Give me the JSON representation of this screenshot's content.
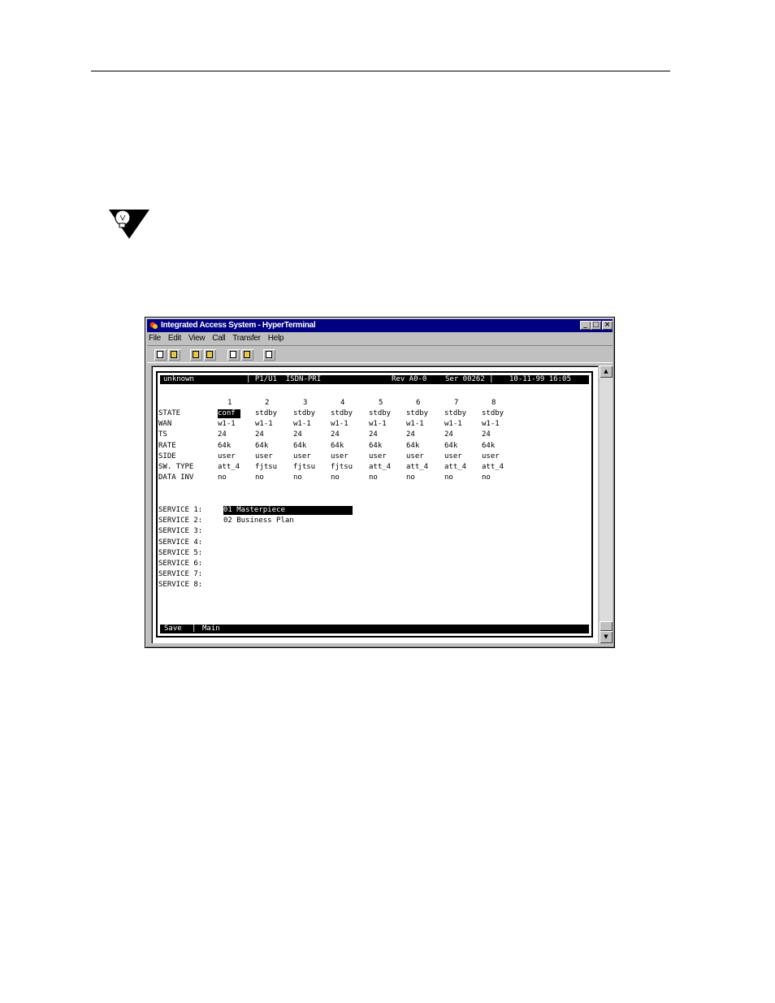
{
  "window": {
    "title": "Integrated Access System - HyperTerminal",
    "buttons": [
      "_",
      "□",
      "×"
    ]
  },
  "menu": [
    "File",
    "Edit",
    "View",
    "Call",
    "Transfer",
    "Help"
  ],
  "toolbar_icons": [
    "new-icon",
    "open-icon",
    "connect-icon",
    "disconnect-icon",
    "send-icon",
    "receive-icon",
    "properties-icon"
  ],
  "status": {
    "name": "unknown",
    "port": "| P1/U1  ISDN-PRI",
    "rev": "Rev A0-0",
    "ser": "Ser 00262 |",
    "datetime": "10-11-99 16:05"
  },
  "columns": [
    "1",
    "2",
    "3",
    "4",
    "5",
    "6",
    "7",
    "8"
  ],
  "rows": [
    {
      "label": "STATE",
      "values": [
        "conf",
        "stdby",
        "stdby",
        "stdby",
        "stdby",
        "stdby",
        "stdby",
        "stdby"
      ]
    },
    {
      "label": "WAN",
      "values": [
        "w1-1",
        "w1-1",
        "w1-1",
        "w1-1",
        "w1-1",
        "w1-1",
        "w1-1",
        "w1-1"
      ]
    },
    {
      "label": "TS",
      "values": [
        "24",
        "24",
        "24",
        "24",
        "24",
        "24",
        "24",
        "24"
      ]
    },
    {
      "label": "RATE",
      "values": [
        "64k",
        "64k",
        "64k",
        "64k",
        "64k",
        "64k",
        "64k",
        "64k"
      ]
    },
    {
      "label": "SIDE",
      "values": [
        "user",
        "user",
        "user",
        "user",
        "user",
        "user",
        "user",
        "user"
      ]
    },
    {
      "label": "SW. TYPE",
      "values": [
        "att_4",
        "fjtsu",
        "fjtsu",
        "fjtsu",
        "att_4",
        "att_4",
        "att_4",
        "att_4"
      ]
    },
    {
      "label": "DATA INV",
      "values": [
        "no",
        "no",
        "no",
        "no",
        "no",
        "no",
        "no",
        "no"
      ]
    }
  ],
  "services": [
    {
      "label": "SERVICE 1:",
      "value": "01 Masterpiece"
    },
    {
      "label": "SERVICE 2:",
      "value": "02 Business Plan"
    },
    {
      "label": "SERVICE 3:",
      "value": ""
    },
    {
      "label": "SERVICE 4:",
      "value": ""
    },
    {
      "label": "SERVICE 5:",
      "value": ""
    },
    {
      "label": "SERVICE 6:",
      "value": ""
    },
    {
      "label": "SERVICE 7:",
      "value": ""
    },
    {
      "label": "SERVICE 8:",
      "value": ""
    }
  ],
  "bottom": {
    "save": "Save",
    "sep": "|",
    "main": "Main"
  }
}
